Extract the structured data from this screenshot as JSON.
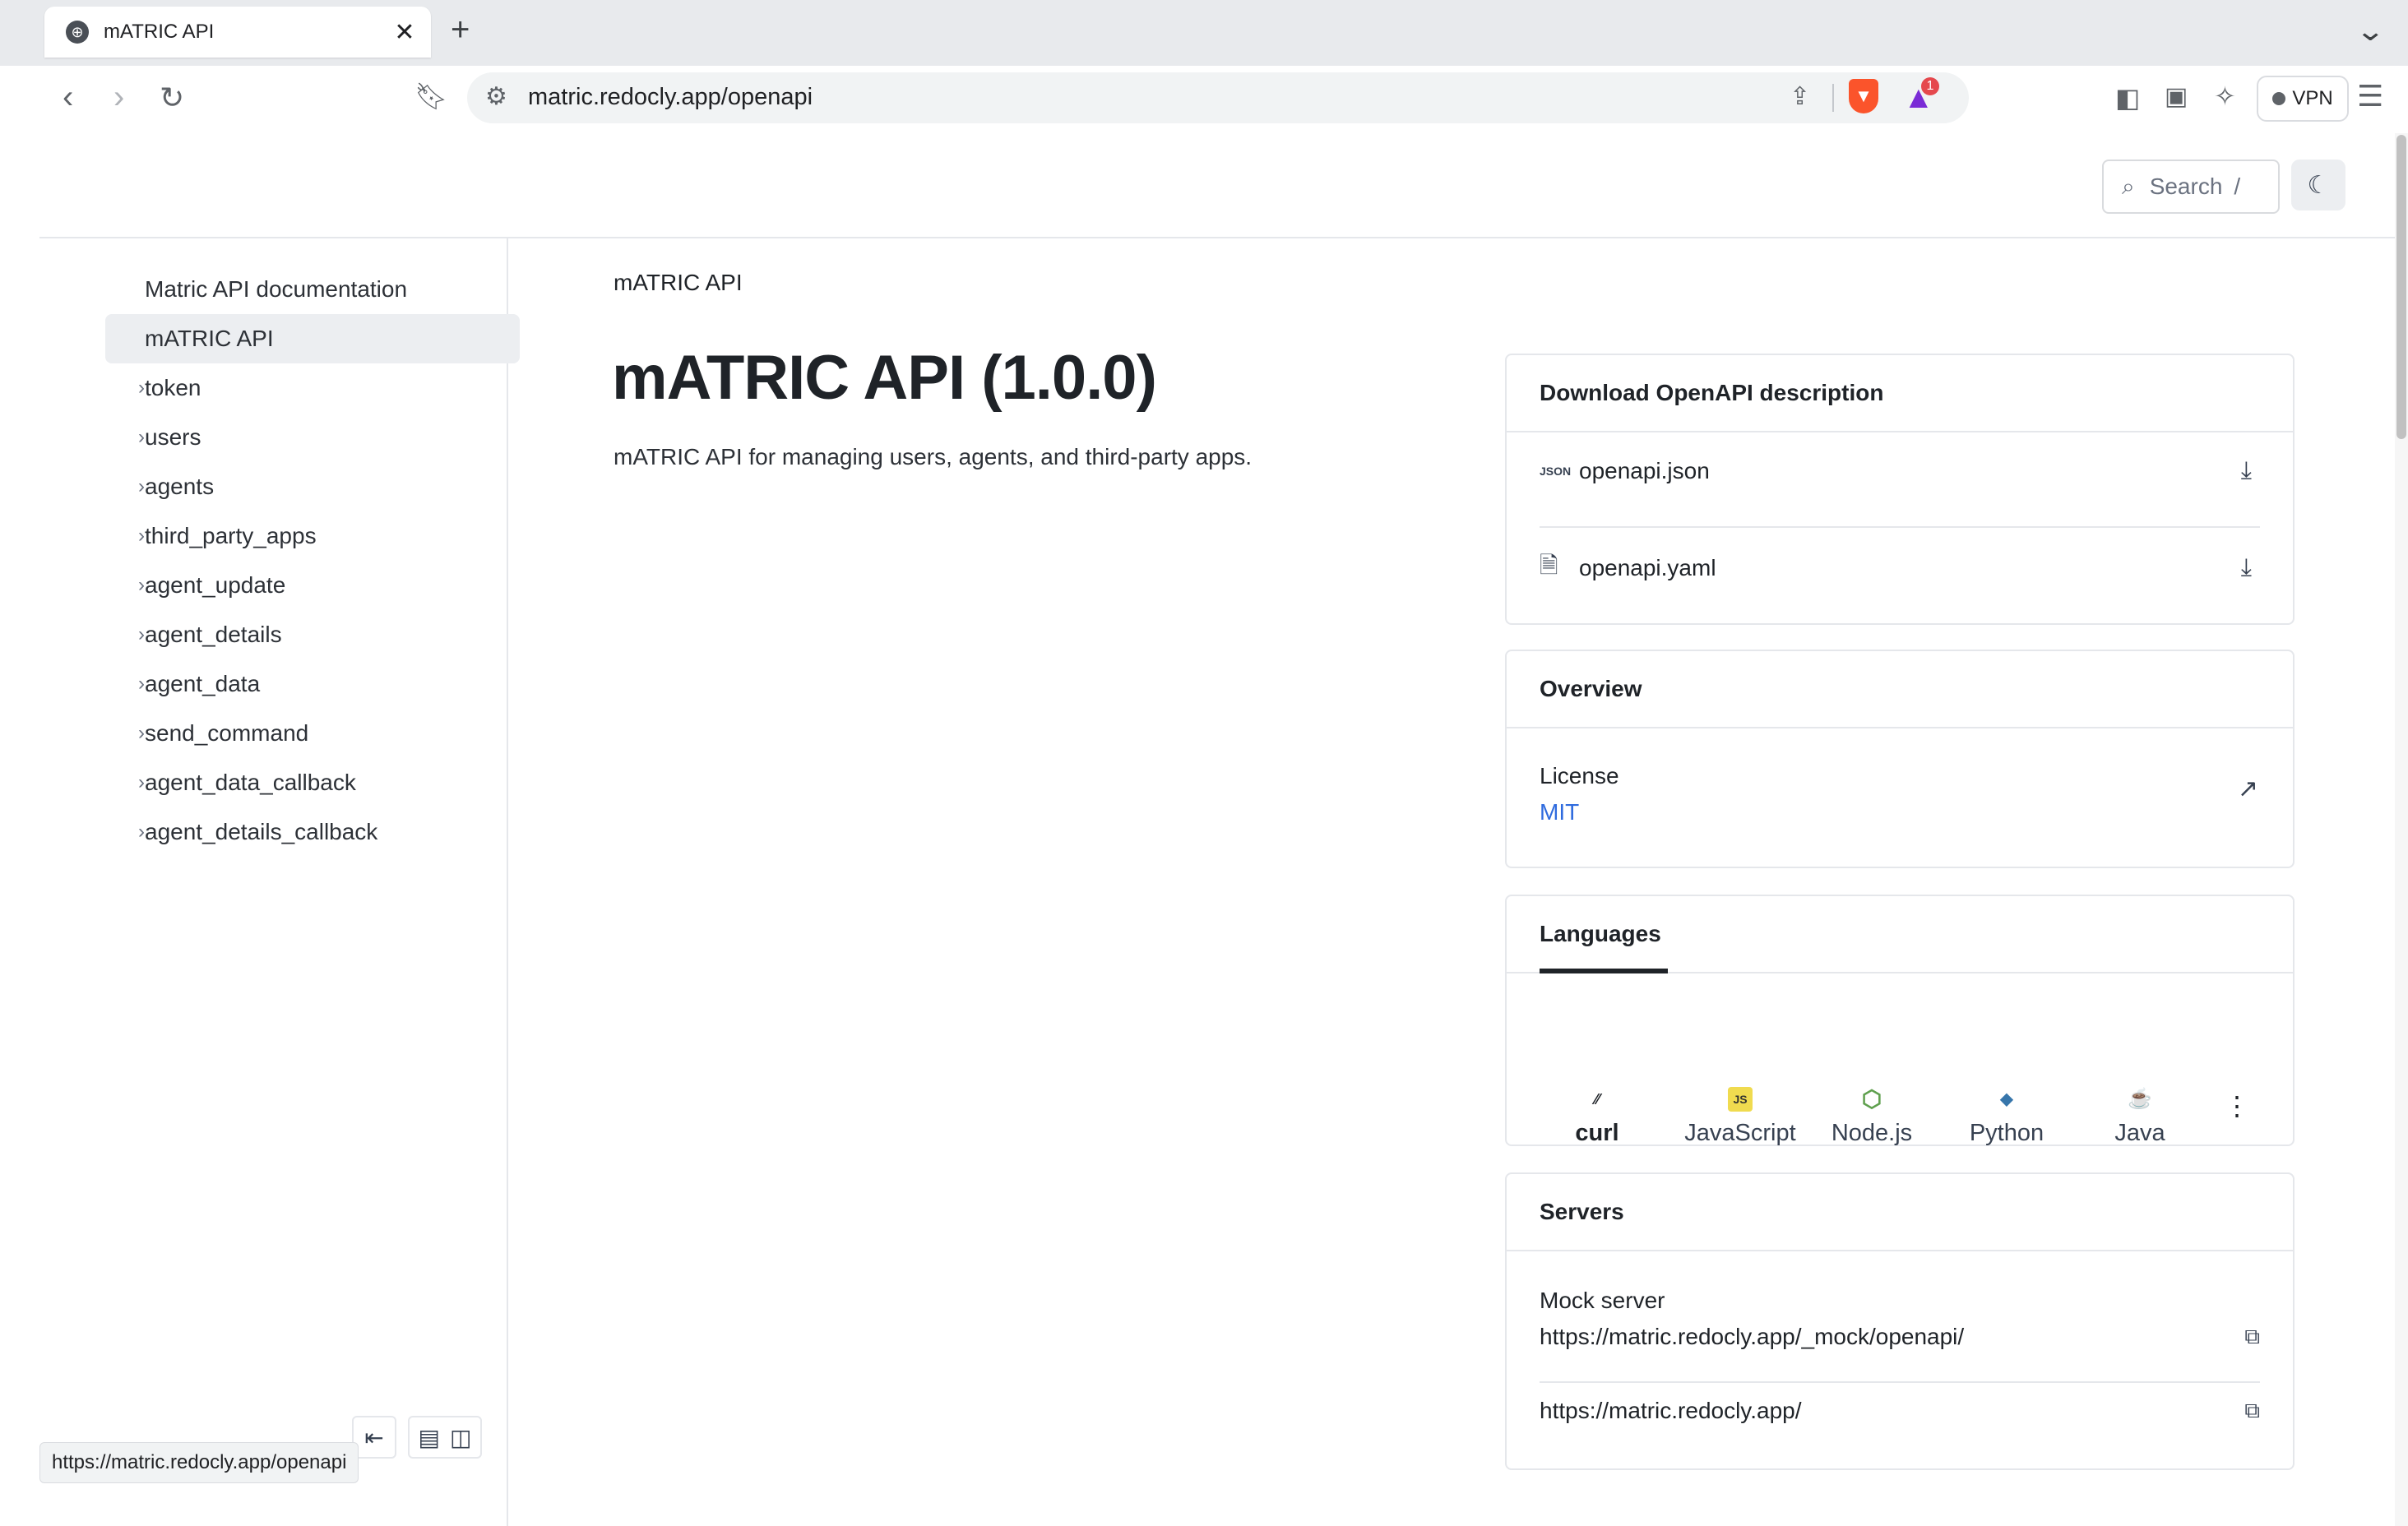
{
  "browser": {
    "tab_title": "mATRIC API",
    "tab_close": "✕",
    "new_tab": "+",
    "url": "matric.redocly.app/openapi",
    "vpn_label": "VPN",
    "notification_count": "1",
    "status_url": "https://matric.redocly.app/openapi"
  },
  "header": {
    "search_placeholder": "Search",
    "search_shortcut": "/"
  },
  "sidebar": {
    "items": [
      {
        "label": "Matric API documentation",
        "expandable": false,
        "active": false
      },
      {
        "label": "mATRIC API",
        "expandable": false,
        "active": true
      },
      {
        "label": "token",
        "expandable": true,
        "active": false
      },
      {
        "label": "users",
        "expandable": true,
        "active": false
      },
      {
        "label": "agents",
        "expandable": true,
        "active": false
      },
      {
        "label": "third_party_apps",
        "expandable": true,
        "active": false
      },
      {
        "label": "agent_update",
        "expandable": true,
        "active": false
      },
      {
        "label": "agent_details",
        "expandable": true,
        "active": false
      },
      {
        "label": "agent_data",
        "expandable": true,
        "active": false
      },
      {
        "label": "send_command",
        "expandable": true,
        "active": false
      },
      {
        "label": "agent_data_callback",
        "expandable": true,
        "active": false
      },
      {
        "label": "agent_details_callback",
        "expandable": true,
        "active": false
      }
    ]
  },
  "main": {
    "breadcrumb": "mATRIC API",
    "title": "mATRIC API (1.0.0)",
    "description": "mATRIC API for managing users, agents, and third-party apps."
  },
  "download_card": {
    "title": "Download OpenAPI description",
    "files": [
      {
        "name": "openapi.json",
        "icon": "json-file-icon",
        "icon_text": "JSON"
      },
      {
        "name": "openapi.yaml",
        "icon": "file-icon",
        "icon_text": "🗎"
      }
    ]
  },
  "overview_card": {
    "title": "Overview",
    "license_label": "License",
    "license_value": "MIT",
    "link_color": "#2f6bde"
  },
  "languages_card": {
    "tab_label": "Languages",
    "languages": [
      {
        "name": "curl",
        "icon": "curl-icon",
        "glyph": "⁄⁄",
        "selected": true
      },
      {
        "name": "JavaScript",
        "icon": "javascript-icon",
        "glyph": "JS",
        "selected": false
      },
      {
        "name": "Node.js",
        "icon": "nodejs-icon",
        "glyph": "⬡",
        "selected": false
      },
      {
        "name": "Python",
        "icon": "python-icon",
        "glyph": "◆",
        "selected": false
      },
      {
        "name": "Java",
        "icon": "java-icon",
        "glyph": "☕",
        "selected": false
      }
    ],
    "more": "⋮"
  },
  "servers_card": {
    "title": "Servers",
    "servers": [
      {
        "label": "Mock server",
        "url": "https://matric.redocly.app/_mock/openapi/"
      },
      {
        "label": "",
        "url": "https://matric.redocly.app/"
      }
    ]
  }
}
